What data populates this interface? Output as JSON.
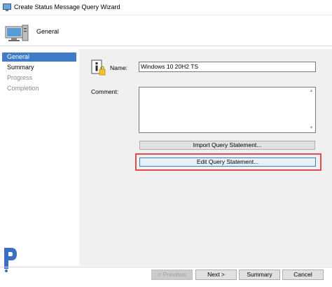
{
  "window": {
    "title": "Create Status Message Query Wizard"
  },
  "header": {
    "title": "General"
  },
  "sidebar": {
    "items": [
      {
        "label": "General",
        "state": "active"
      },
      {
        "label": "Summary",
        "state": "done"
      },
      {
        "label": "Progress",
        "state": "disabled"
      },
      {
        "label": "Completion",
        "state": "disabled"
      }
    ]
  },
  "form": {
    "name_label": "Name:",
    "name_value": "Windows 10 20H2 TS",
    "comment_label": "Comment:",
    "comment_value": ""
  },
  "buttons": {
    "import_query": "Import Query Statement...",
    "edit_query": "Edit Query Statement...",
    "previous": "< Previous",
    "next": "Next >",
    "summary": "Summary",
    "cancel": "Cancel"
  },
  "colors": {
    "active_nav": "#3e7cc8",
    "highlight": "#e14c4c",
    "content_bg": "#f0f0f0"
  }
}
